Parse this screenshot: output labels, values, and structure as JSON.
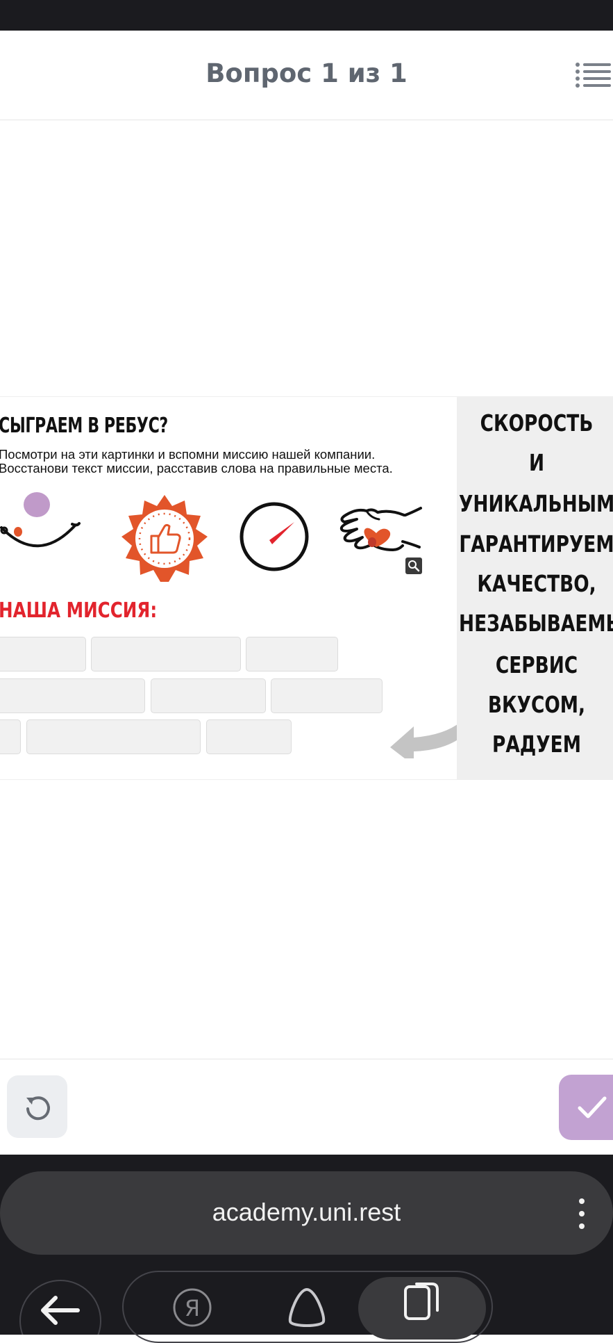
{
  "header": {
    "title": "Вопрос 1 из 1"
  },
  "rebus": {
    "title": "СЫГРАЕМ В РЕБУС?",
    "subtitle_line1": "Посмотри на эти картинки и вспомни миссию нашей компании.",
    "subtitle_line2": "Восстанови текст миссии, расставив слова на правильные места.",
    "mission_label": "НАША МИССИЯ:",
    "pictures": [
      "smile-icon",
      "thumbs-up-badge-icon",
      "speedometer-icon",
      "hand-heart-icon"
    ]
  },
  "words": [
    "СКОРОСТЬ",
    "И",
    "УНИКАЛЬНЫМ",
    "ГАРАНТИРУЕМ",
    "КАЧЕСТВО,",
    "НЕЗАБЫВАЕМЫЙ",
    "СЕРВИС",
    "ВКУСОМ,",
    "РАДУЕМ"
  ],
  "browser": {
    "url": "academy.uni.rest"
  },
  "colors": {
    "accent_red": "#e2242d",
    "badge_orange": "#e2552a",
    "submit_purple": "#c2a2d2",
    "smile_purple": "#c09ac9"
  }
}
